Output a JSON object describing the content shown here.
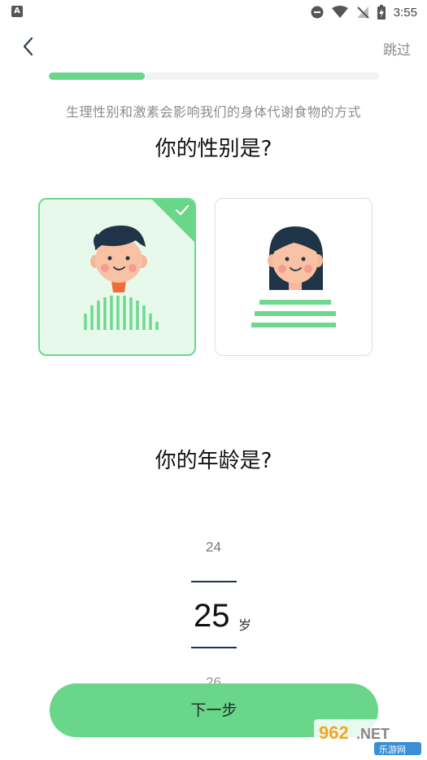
{
  "status_bar": {
    "time": "3:55",
    "icons": [
      "a-notification-icon",
      "dnd-icon",
      "wifi-icon",
      "no-signal-icon",
      "battery-charging-icon"
    ]
  },
  "header": {
    "back_icon": "chevron-left-icon",
    "skip_label": "跳过"
  },
  "progress": {
    "value_percent": 29
  },
  "subtitle": "生理性别和激素会影响我们的身体代谢食物的方式",
  "gender_question": "你的性别是?",
  "gender_options": [
    {
      "key": "male",
      "selected": true
    },
    {
      "key": "female",
      "selected": false
    }
  ],
  "age_question": "你的年龄是?",
  "age_picker": {
    "prev": "24",
    "current": "25",
    "unit": "岁",
    "next": "26"
  },
  "next_button_label": "下一步",
  "colors": {
    "accent": "#69d68a",
    "selected_card_bg": "#e6f9ea",
    "picker_line": "#1f3446"
  },
  "watermark": {
    "brand": "962.NET",
    "sub": "乐游网"
  }
}
